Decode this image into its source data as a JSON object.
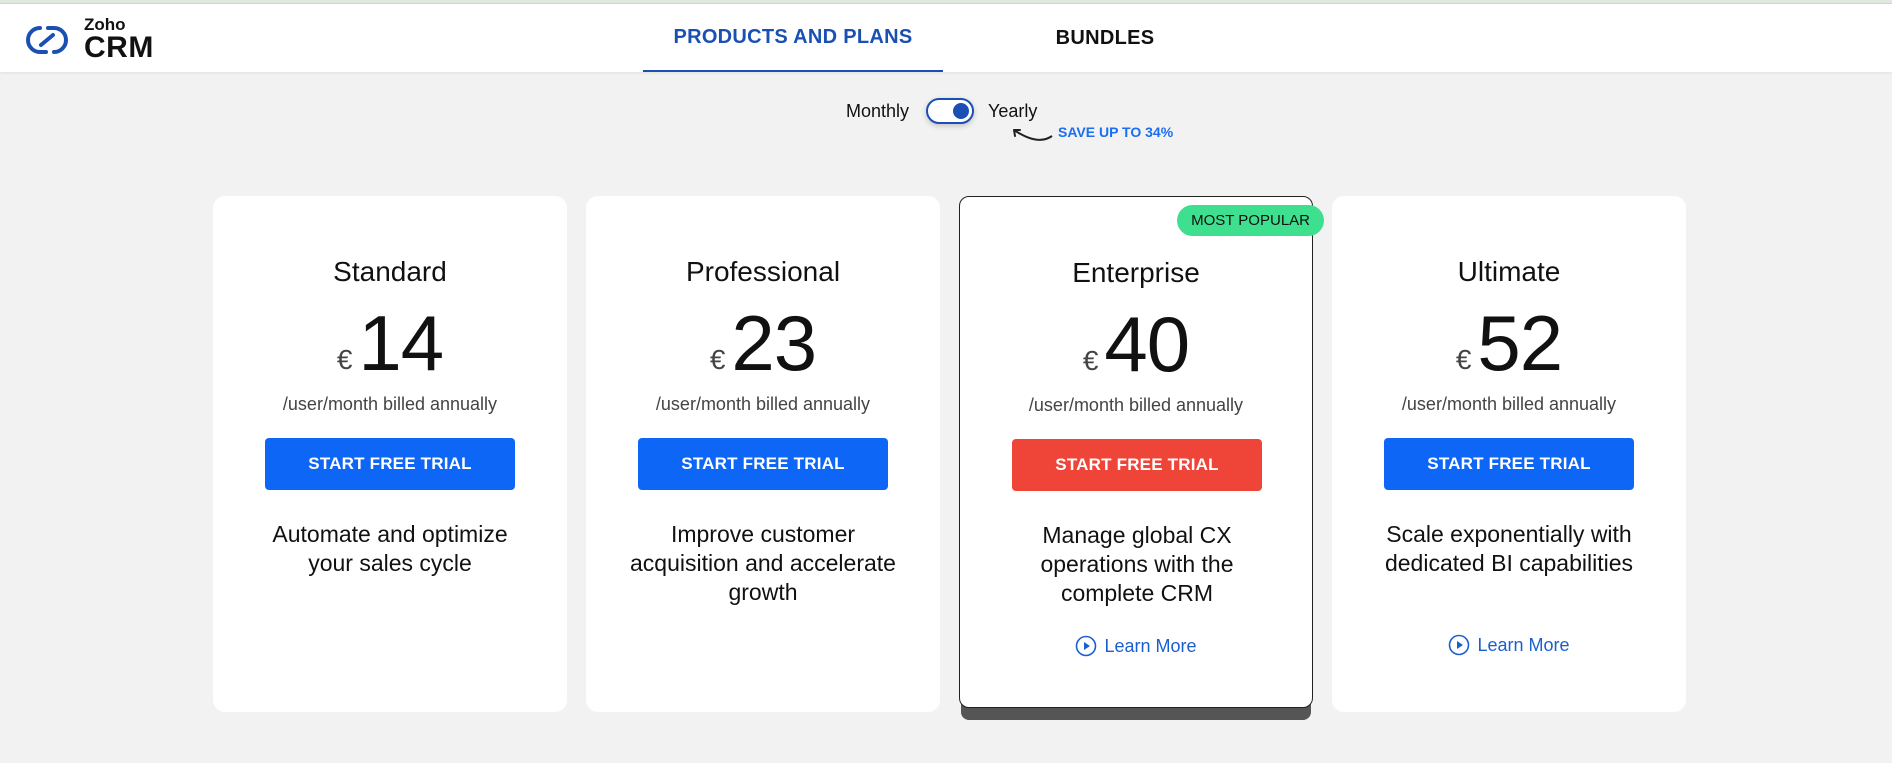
{
  "header": {
    "logo": {
      "brand": "Zoho",
      "product": "CRM"
    },
    "tabs": [
      {
        "label": "PRODUCTS AND PLANS",
        "active": true
      },
      {
        "label": "BUNDLES",
        "active": false
      }
    ]
  },
  "billing_toggle": {
    "left_label": "Monthly",
    "right_label": "Yearly",
    "selected": "Yearly",
    "save_note": "SAVE UP TO 34%"
  },
  "plans": [
    {
      "name": "Standard",
      "currency": "€",
      "price": "14",
      "billing": "/user/month billed annually",
      "cta": "START FREE TRIAL",
      "description": "Automate and optimize your sales cycle",
      "learn_more": null,
      "badge": null
    },
    {
      "name": "Professional",
      "currency": "€",
      "price": "23",
      "billing": "/user/month billed annually",
      "cta": "START FREE TRIAL",
      "description": "Improve customer acquisition and accelerate growth",
      "learn_more": null,
      "badge": null
    },
    {
      "name": "Enterprise",
      "currency": "€",
      "price": "40",
      "billing": "/user/month billed annually",
      "cta": "START FREE TRIAL",
      "description": "Manage global CX operations with the complete CRM",
      "learn_more": "Learn More",
      "badge": "MOST POPULAR"
    },
    {
      "name": "Ultimate",
      "currency": "€",
      "price": "52",
      "billing": "/user/month billed annually",
      "cta": "START FREE TRIAL",
      "description": "Scale exponentially with dedicated BI capabilities",
      "learn_more": "Learn More",
      "badge": null
    }
  ],
  "colors": {
    "accent": "#1a4fb3",
    "cta_blue": "#0d66f5",
    "cta_featured": "#ef4438",
    "badge": "#3ee08f",
    "background": "#f2f2f2"
  },
  "icons": {
    "logo": "zoho-logo-icon",
    "learn_more": "play-circle-icon",
    "save_arrow": "curved-arrow-icon"
  }
}
